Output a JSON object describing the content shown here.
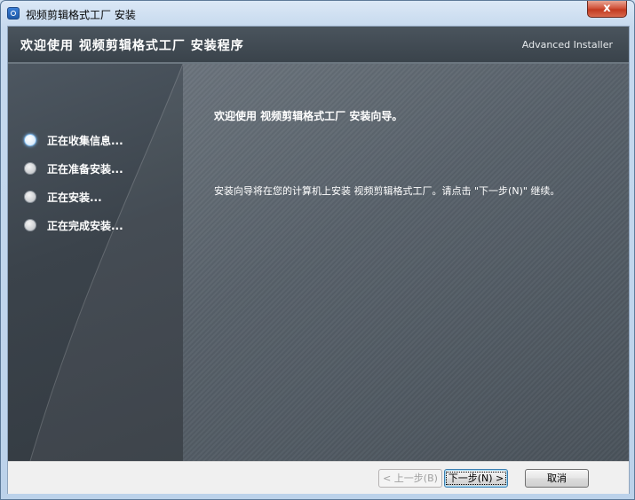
{
  "window": {
    "title": "视频剪辑格式工厂 安装",
    "close_label": "x"
  },
  "header": {
    "title": "欢迎使用 视频剪辑格式工厂 安装程序",
    "brand": "Advanced Installer"
  },
  "steps": [
    {
      "label": "正在收集信息...",
      "active": true
    },
    {
      "label": "正在准备安装...",
      "active": false
    },
    {
      "label": "正在安装...",
      "active": false
    },
    {
      "label": "正在完成安装...",
      "active": false
    }
  ],
  "content": {
    "heading": "欢迎使用 视频剪辑格式工厂 安装向导。",
    "body": "安装向导将在您的计算机上安装 视频剪辑格式工厂。请点击 \"下一步(N)\" 继续。"
  },
  "buttons": {
    "back": "< 上一步(B)",
    "next": "下一步(N) >",
    "cancel": "取消"
  },
  "colors": {
    "header_bg": "#434c55",
    "sidebar_bg": "#3b434b",
    "content_bg": "#58616a",
    "window_frame": "#c6d9ee",
    "close_button": "#c23b21"
  }
}
